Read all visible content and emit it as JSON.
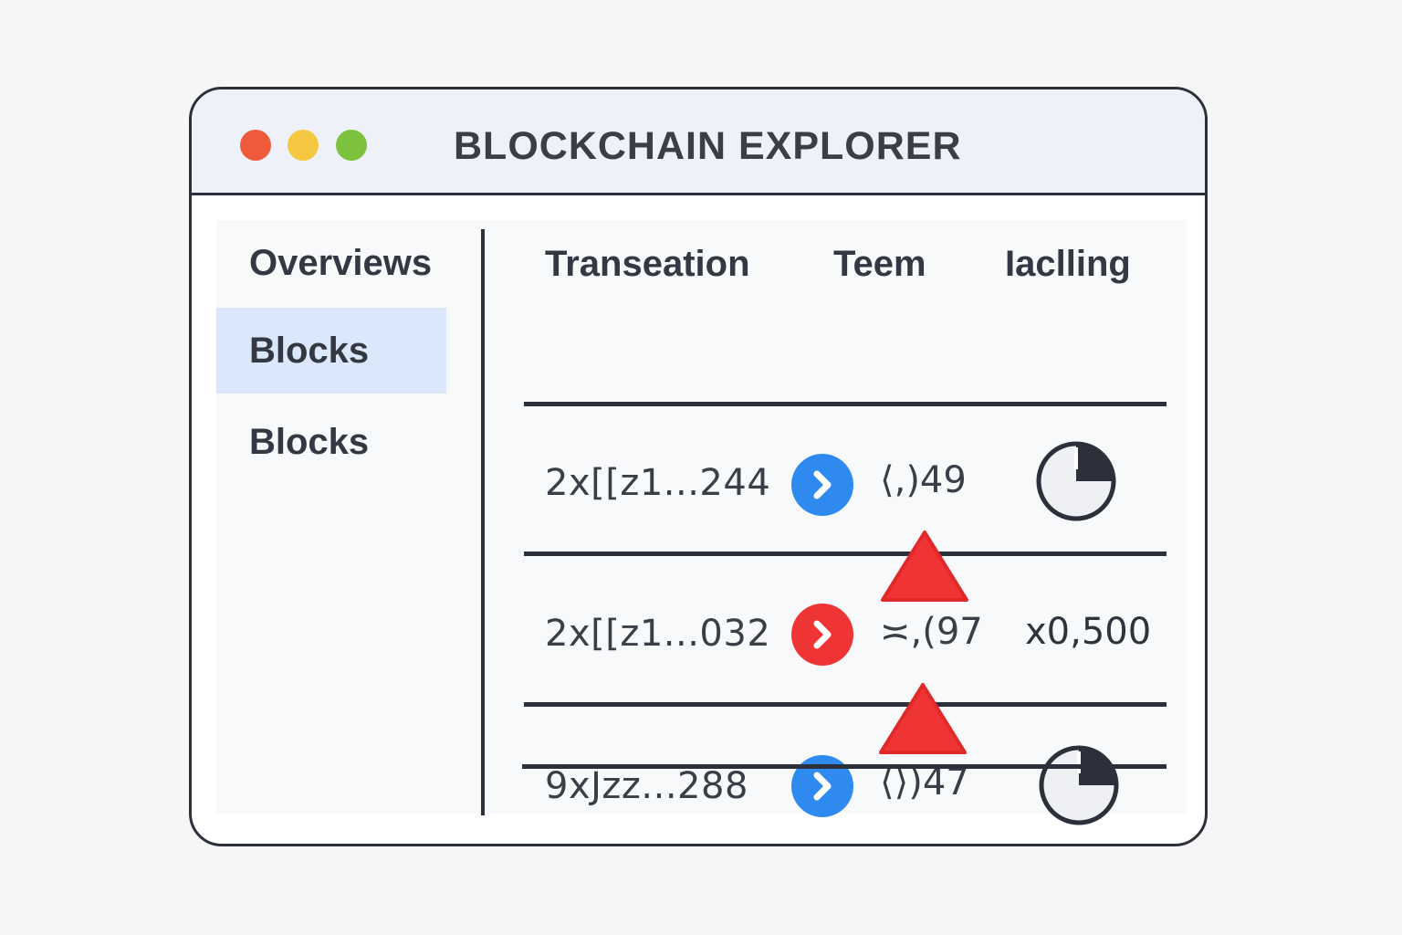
{
  "window": {
    "title": "BLOCKCHAIN EXPLORER",
    "controls": {
      "close_color": "#f05a3c",
      "minimize_color": "#f5c842",
      "maximize_color": "#7dc23d"
    }
  },
  "sidebar": {
    "items": [
      {
        "label": "Overviews",
        "active": false
      },
      {
        "label": "Blocks",
        "active": true
      },
      {
        "label": "Blocks",
        "active": false
      }
    ]
  },
  "table": {
    "headers": [
      "Transeation",
      "Teem",
      "Iaclling"
    ],
    "rows": [
      {
        "tx": "2x[[z1...244",
        "action_color": "#2f8af0",
        "team": "⟨,)49",
        "status": "clock-icon"
      },
      {
        "tx": "2x[[z1...032",
        "action_color": "#ee3434",
        "team": "≍,(97",
        "amount": "x0,500"
      },
      {
        "tx": "9xJzz...288",
        "action_color": "#2f8af0",
        "team": "⟨⟩)47",
        "status": "clock-icon"
      }
    ]
  },
  "colors": {
    "accent_blue": "#2f8af0",
    "alert_red": "#ee3434",
    "border": "#2b303a",
    "active_bg": "#dbe8fb"
  }
}
